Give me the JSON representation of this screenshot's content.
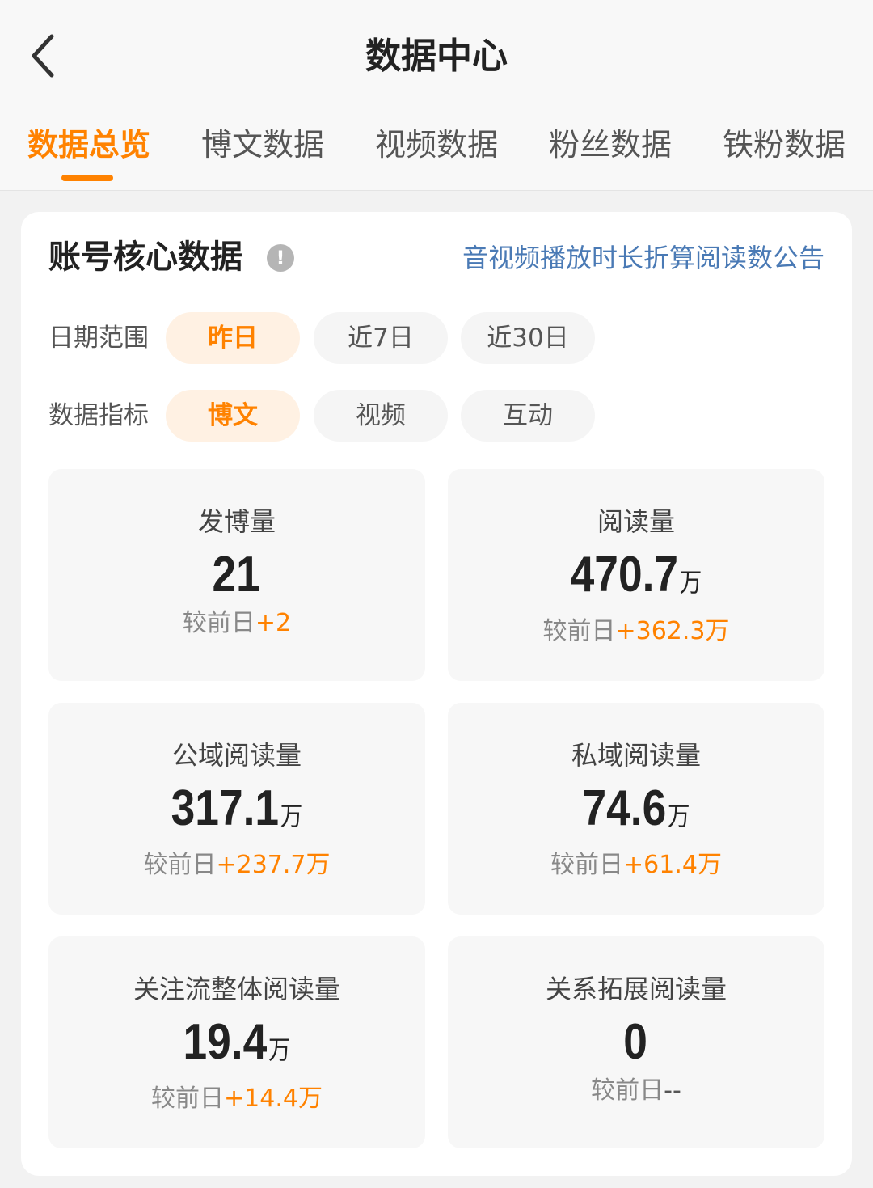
{
  "header": {
    "title": "数据中心",
    "tabs": [
      {
        "label": "数据总览",
        "active": true
      },
      {
        "label": "博文数据",
        "active": false
      },
      {
        "label": "视频数据",
        "active": false
      },
      {
        "label": "粉丝数据",
        "active": false
      },
      {
        "label": "铁粉数据",
        "active": false
      }
    ]
  },
  "core": {
    "title": "账号核心数据",
    "info_icon": "!",
    "notice_link": "音视频播放时长折算阅读数公告",
    "date_range": {
      "label": "日期范围",
      "options": [
        "昨日",
        "近7日",
        "近30日"
      ],
      "selected": "昨日"
    },
    "metric_type": {
      "label": "数据指标",
      "options": [
        "博文",
        "视频",
        "互动"
      ],
      "selected": "博文"
    },
    "stats": [
      {
        "label": "发博量",
        "value": "21",
        "unit": "",
        "compare_prefix": "较前日",
        "delta": "+2"
      },
      {
        "label": "阅读量",
        "value": "470.7",
        "unit": "万",
        "compare_prefix": "较前日",
        "delta": "+362.3万"
      },
      {
        "label": "公域阅读量",
        "value": "317.1",
        "unit": "万",
        "compare_prefix": "较前日",
        "delta": "+237.7万"
      },
      {
        "label": "私域阅读量",
        "value": "74.6",
        "unit": "万",
        "compare_prefix": "较前日",
        "delta": "+61.4万"
      },
      {
        "label": "关注流整体阅读量",
        "value": "19.4",
        "unit": "万",
        "compare_prefix": "较前日",
        "delta": "+14.4万"
      },
      {
        "label": "关系拓展阅读量",
        "value": "0",
        "unit": "",
        "compare_prefix": "较前日",
        "delta": "--"
      }
    ]
  },
  "colors": {
    "accent": "#ff8200",
    "link": "#4a7ab5",
    "chip_active_bg": "#fff1e3"
  }
}
